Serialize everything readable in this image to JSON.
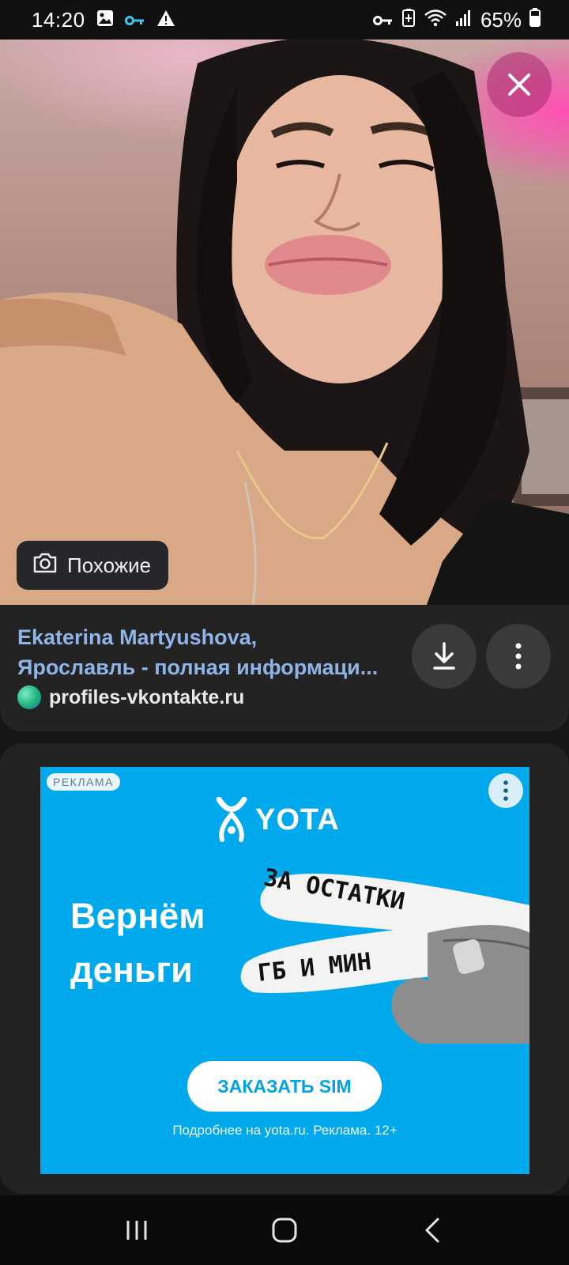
{
  "status_bar": {
    "time": "14:20",
    "battery": "65%",
    "icons_left": [
      "gallery-icon",
      "key-icon",
      "warning-icon"
    ],
    "icons_right": [
      "vpn-key-icon",
      "battery-saver-icon",
      "wifi-icon",
      "signal-icon",
      "battery-icon"
    ]
  },
  "image_viewer": {
    "similar_button": "Похожие"
  },
  "result": {
    "title_line1": "Ekaterina Martyushova,",
    "title_line2": "Ярославль - полная информаци...",
    "source": "profiles-vkontakte.ru"
  },
  "ad": {
    "label": "РЕКЛАМА",
    "brand": "YOTA",
    "headline_line1": "Вернём",
    "headline_line2": "деньги",
    "finger_text_1": "ЗА ОСТАТКИ",
    "finger_text_2": "ГБ И МИН",
    "cta": "ЗАКАЗАТЬ SIM",
    "footer": "Подробнее на yota.ru. Реклама. 12+"
  },
  "colors": {
    "background": "#161616",
    "card": "#232323",
    "link": "#8fb4e8",
    "ad_blue": "#00a8ec"
  }
}
